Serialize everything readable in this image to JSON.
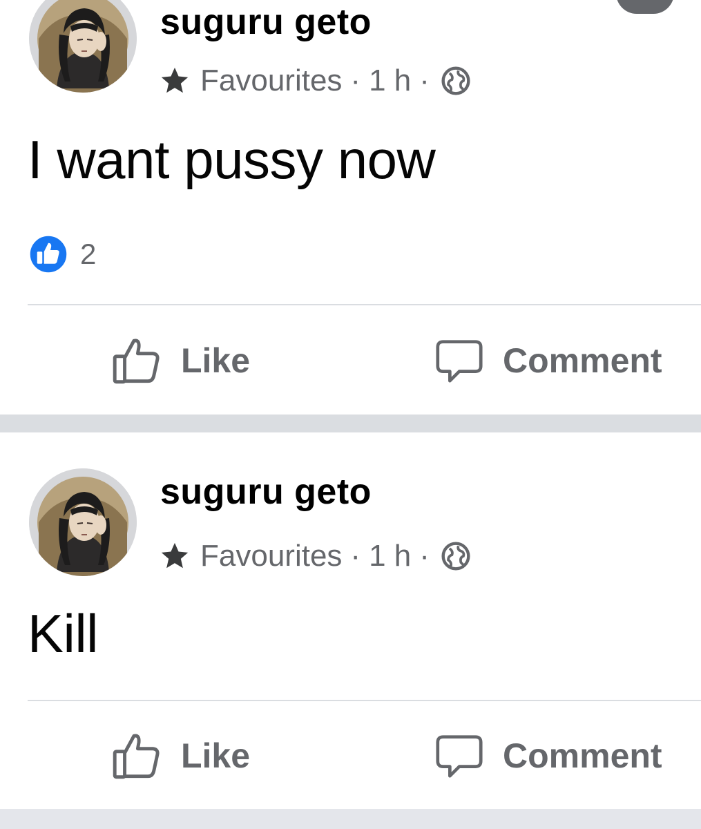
{
  "posts": [
    {
      "author": "suguru geto",
      "audience_label": "Favourites",
      "dot1": "·",
      "time": "1 h",
      "dot2": "·",
      "text": "I want pussy now",
      "reaction_count": "2",
      "actions": {
        "like": "Like",
        "comment": "Comment"
      }
    },
    {
      "author": "suguru geto",
      "audience_label": "Favourites",
      "dot1": "·",
      "time": "1 h",
      "dot2": "·",
      "text": "Kill",
      "actions": {
        "like": "Like",
        "comment": "Comment"
      }
    }
  ],
  "colors": {
    "meta_gray": "#65676b",
    "like_blue": "#1877f2",
    "separator": "#dadde1"
  },
  "icons": {
    "avatar": "anime-character-avatar",
    "audience": "star-icon",
    "privacy": "globe-icon",
    "reaction": "like-badge-icon",
    "like_action": "thumbs-up-outline-icon",
    "comment_action": "speech-bubble-icon"
  }
}
